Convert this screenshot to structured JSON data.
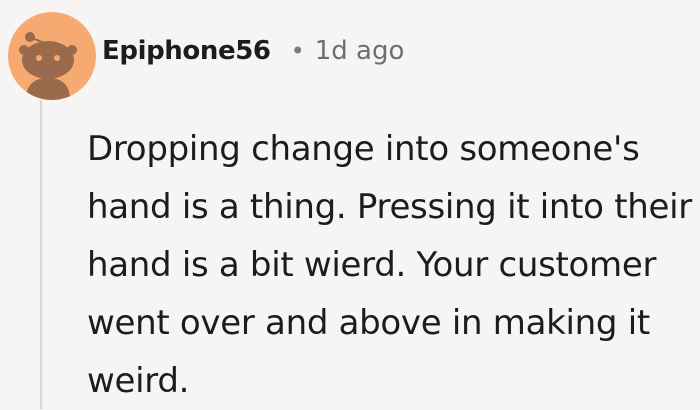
{
  "comment": {
    "username": "Epiphone56",
    "separator": "•",
    "timestamp": "1d ago",
    "body": "Dropping change into someone's hand is a thing. Pressing it into their hand is a bit wierd. Your customer went over and above in making it weird.",
    "avatar_icon": "reddit-snoo-avatar-icon"
  },
  "colors": {
    "background": "#f7f5f4",
    "avatar_bg": "#f7a972",
    "avatar_figure": "#9a6a4c",
    "thread_line": "#dad7d5",
    "text": "#1c1c1c",
    "meta_text": "#6f6f6f"
  }
}
